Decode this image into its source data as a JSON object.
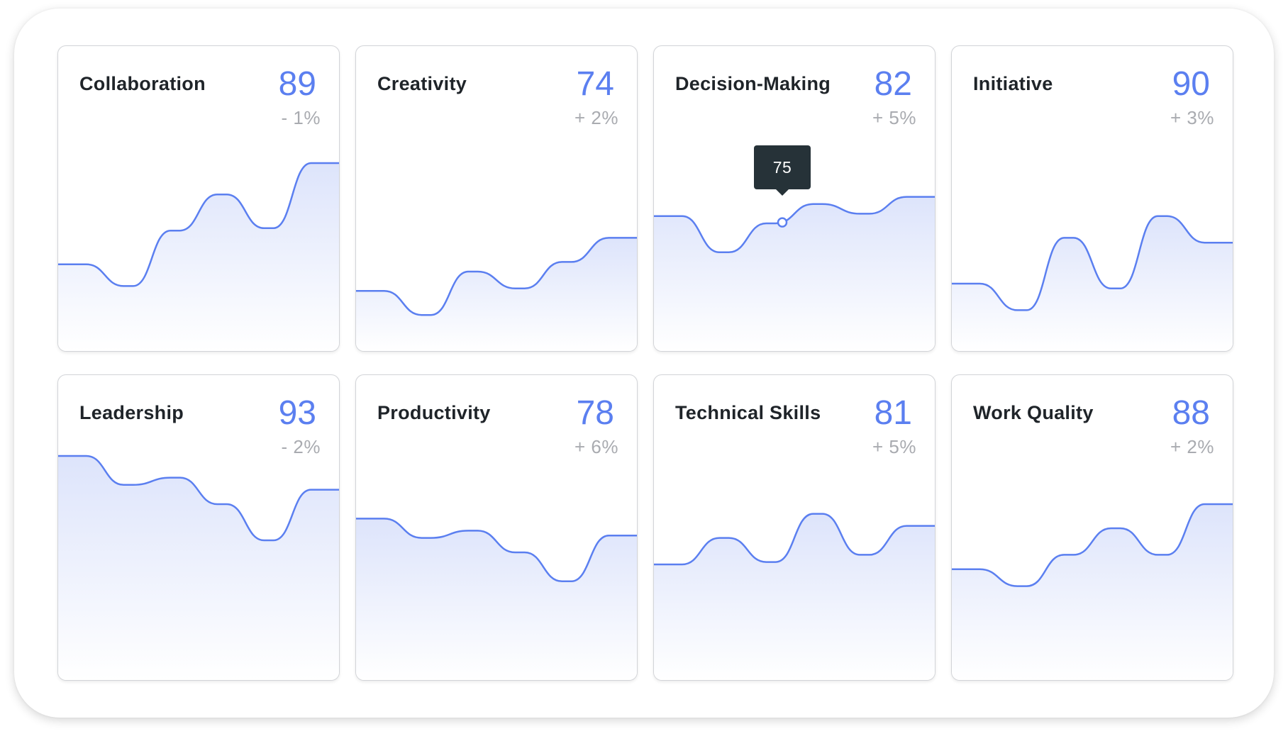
{
  "chart_data": [
    {
      "type": "area",
      "title": "Collaboration",
      "y": [
        33,
        24,
        47,
        62,
        48,
        75
      ],
      "ylim": [
        0,
        100
      ]
    },
    {
      "type": "area",
      "title": "Creativity",
      "y": [
        22,
        12,
        30,
        23,
        34,
        44
      ],
      "ylim": [
        0,
        100
      ]
    },
    {
      "type": "area",
      "title": "Decision-Making",
      "y": [
        53,
        38,
        50,
        58,
        54,
        61
      ],
      "ylim": [
        0,
        100
      ]
    },
    {
      "type": "area",
      "title": "Initiative",
      "y": [
        25,
        14,
        44,
        23,
        53,
        42
      ],
      "ylim": [
        0,
        100
      ]
    },
    {
      "type": "area",
      "title": "Leadership",
      "y": [
        90,
        78,
        81,
        70,
        55,
        76
      ],
      "ylim": [
        0,
        100
      ]
    },
    {
      "type": "area",
      "title": "Productivity",
      "y": [
        64,
        56,
        59,
        50,
        38,
        57
      ],
      "ylim": [
        0,
        100
      ]
    },
    {
      "type": "area",
      "title": "Technical Skills",
      "y": [
        45,
        56,
        46,
        66,
        49,
        61
      ],
      "ylim": [
        0,
        100
      ]
    },
    {
      "type": "area",
      "title": "Work Quality",
      "y": [
        43,
        36,
        49,
        60,
        49,
        70
      ],
      "ylim": [
        0,
        100
      ]
    }
  ],
  "cards": [
    {
      "title": "Collaboration",
      "value": "89",
      "change": "- 1%"
    },
    {
      "title": "Creativity",
      "value": "74",
      "change": "+ 2%"
    },
    {
      "title": "Decision-Making",
      "value": "82",
      "change": "+ 5%",
      "tooltip": "75"
    },
    {
      "title": "Initiative",
      "value": "90",
      "change": "+ 3%"
    },
    {
      "title": "Leadership",
      "value": "93",
      "change": "- 2%"
    },
    {
      "title": "Productivity",
      "value": "78",
      "change": "+ 6%"
    },
    {
      "title": "Technical Skills",
      "value": "81",
      "change": "+ 5%"
    },
    {
      "title": "Work Quality",
      "value": "88",
      "change": "+ 2%"
    }
  ],
  "colors": {
    "line": "#5b7ff0",
    "fill_top": "#dde4fb",
    "fill_bottom": "#ffffff",
    "value": "#5b7ff0",
    "change": "#a9abb0",
    "title": "#1f2429",
    "tooltip_bg": "#263238"
  }
}
